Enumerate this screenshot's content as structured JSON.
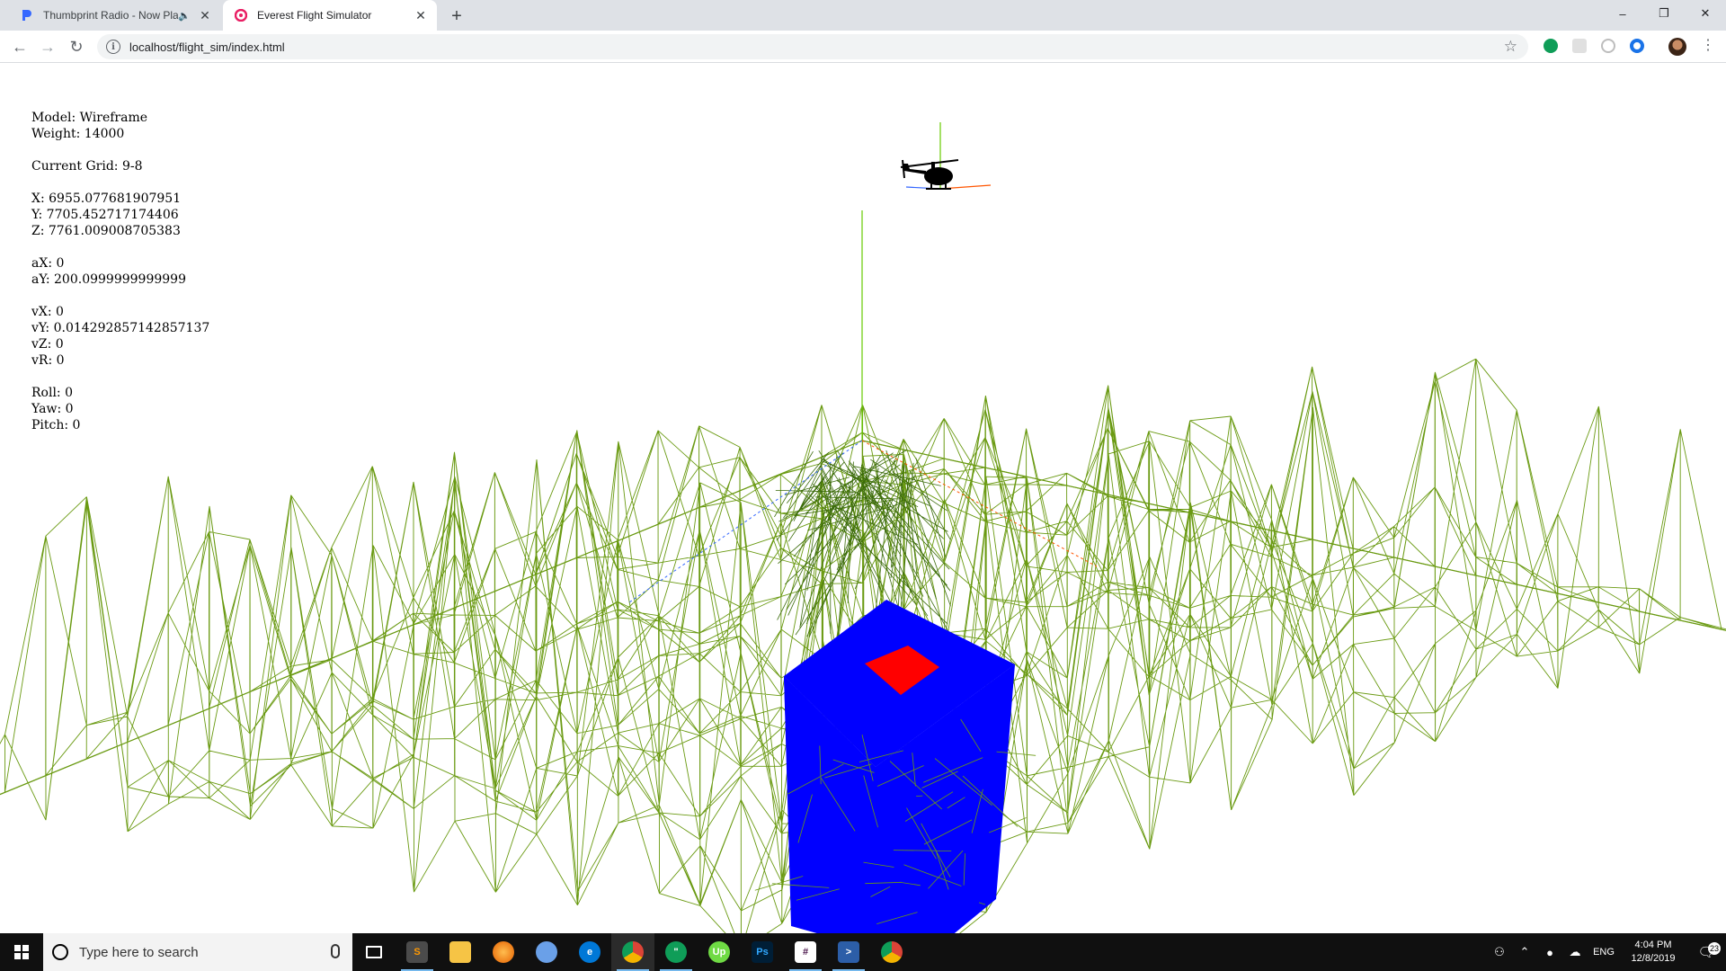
{
  "browser": {
    "tabs": [
      {
        "title": "Thumbprint Radio - Now Pla",
        "active": false,
        "audio": true
      },
      {
        "title": "Everest Flight Simulator",
        "active": true,
        "audio": false
      }
    ],
    "new_tab": "+",
    "url": "localhost/flight_sim/index.html",
    "window_controls": {
      "minimize": "–",
      "restore": "❐",
      "close": "✕"
    }
  },
  "hud": {
    "model": "Model: Wireframe",
    "weight": "Weight: 14000",
    "grid": "Current Grid: 9-8",
    "x": "X: 6955.077681907951",
    "y": "Y: 7705.452717174406",
    "z": "Z: 7761.009008705383",
    "ax": "aX: 0",
    "ay": "aY: 200.0999999999999",
    "vx": "vX: 0",
    "vy": "vY: 0.014292857142857137",
    "vz": "vZ: 0",
    "vr": "vR: 0",
    "roll": "Roll: 0",
    "yaw": "Yaw: 0",
    "pitch": "Pitch: 0"
  },
  "scene": {
    "terrain_color": "#6a9a12",
    "terrain_dark_color": "#3b6b0a",
    "building_color": "#0000ff",
    "helipad_color": "#ff0000",
    "axis_green": "#66cc00",
    "axis_red": "#ff5500",
    "axis_blue": "#3366ff"
  },
  "taskbar": {
    "search_placeholder": "Type here to search",
    "apps": [
      "task-view",
      "sublime-text",
      "file-explorer",
      "firefox",
      "browser-blue",
      "edge",
      "chrome",
      "hangouts",
      "upwork",
      "photoshop",
      "slack",
      "powershell",
      "chrome"
    ],
    "language": "ENG",
    "time": "4:04 PM",
    "date": "12/8/2019",
    "notification_count": "23"
  }
}
